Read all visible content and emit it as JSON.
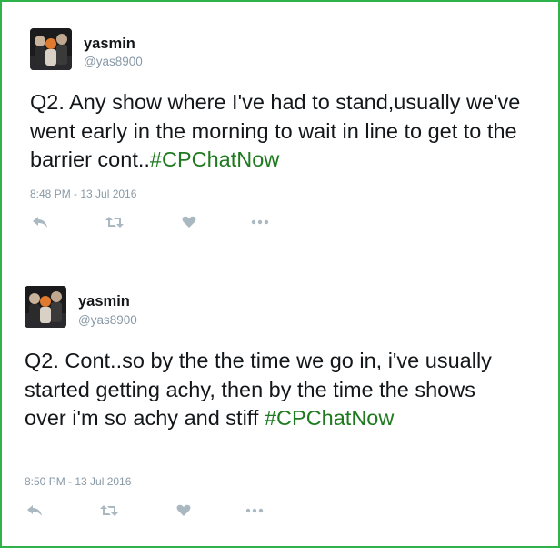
{
  "tweets": [
    {
      "user": {
        "name": "yasmin",
        "handle": "@yas8900"
      },
      "text": "Q2. Any show where I've had to stand,usually we've went early in the morning to wait in line to get to the barrier cont..",
      "hashtag": "#CPChatNow",
      "timestamp": "8:48 PM - 13 Jul 2016",
      "actions": [
        "reply-icon",
        "retweet-icon",
        "like-icon",
        "more-icon"
      ]
    },
    {
      "user": {
        "name": "yasmin",
        "handle": "@yas8900"
      },
      "text": "Q2. Cont..so by the the time we go in, i've usually started getting achy, then by the time the shows over i'm so achy and stiff",
      "hashtag": "#CPChatNow",
      "timestamp": "8:50 PM - 13 Jul 2016",
      "actions": [
        "reply-icon",
        "retweet-icon",
        "like-icon",
        "more-icon"
      ]
    }
  ],
  "colors": {
    "frame": "#2db34a",
    "hashtag": "#1f7a1f",
    "meta": "#8899a6",
    "text": "#14171a"
  }
}
